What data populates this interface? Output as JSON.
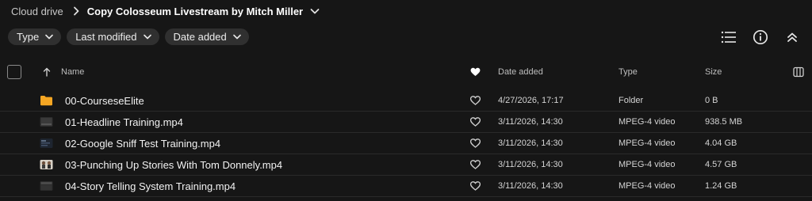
{
  "breadcrumb": {
    "root": "Cloud drive",
    "current": "Copy Colosseum Livestream by Mitch Miller"
  },
  "filters": [
    {
      "label": "Type"
    },
    {
      "label": "Last modified"
    },
    {
      "label": "Date added"
    }
  ],
  "columns": {
    "name": "Name",
    "date_added": "Date added",
    "type": "Type",
    "size": "Size"
  },
  "rows": [
    {
      "name": "00-CourseseElite",
      "date": "4/27/2026, 17:17",
      "type": "Folder",
      "size": "0 B",
      "icon": "folder-icon"
    },
    {
      "name": "01-Headline Training.mp4",
      "date": "3/11/2026, 14:30",
      "type": "MPEG-4 video",
      "size": "938.5 MB",
      "icon": "video-thumbnail"
    },
    {
      "name": "02-Google Sniff Test Training.mp4",
      "date": "3/11/2026, 14:30",
      "type": "MPEG-4 video",
      "size": "4.04 GB",
      "icon": "video-thumbnail"
    },
    {
      "name": "03-Punching Up Stories With Tom Donnely.mp4",
      "date": "3/11/2026, 14:30",
      "type": "MPEG-4 video",
      "size": "4.57 GB",
      "icon": "video-thumbnail"
    },
    {
      "name": "04-Story Telling System Training.mp4",
      "date": "3/11/2026, 14:30",
      "type": "MPEG-4 video",
      "size": "1.24 GB",
      "icon": "video-thumbnail"
    }
  ],
  "colors": {
    "background": "#161616",
    "chip": "#303030",
    "folder": "#f5a623"
  }
}
